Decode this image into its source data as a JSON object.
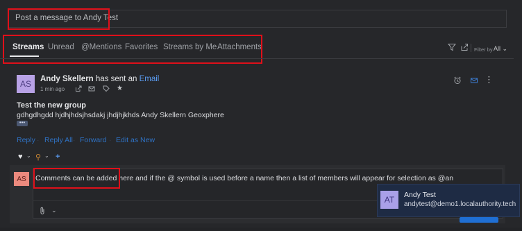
{
  "composer": {
    "placeholder": "Post a message to Andy Test"
  },
  "tabs": [
    {
      "label": "Streams",
      "active": true
    },
    {
      "label": "Unread",
      "active": false
    },
    {
      "label": "@Mentions",
      "active": false
    },
    {
      "label": "Favorites",
      "active": false
    },
    {
      "label": "Streams by Me",
      "active": false
    },
    {
      "label": "Attachments",
      "active": false
    }
  ],
  "toolbar": {
    "filter_label": "Filter by",
    "filter_value": "All",
    "filter_icon": "funnel-icon",
    "share_icon": "share-icon"
  },
  "message": {
    "avatar_initials": "AS",
    "sender_name": "Andy Skellern",
    "sender_action": "has sent an",
    "sender_link": "Email",
    "time": "1 min ago",
    "meta_icons": [
      "external-link-icon",
      "envelope-icon",
      "tag-icon",
      "star-icon"
    ],
    "title": "Test the new group",
    "body": "gdhgdhgdd hjdhjhdsjhsdakj jhdjhjkhds Andy Skellern Geoxphere",
    "more_label": "•••",
    "right_icons": [
      "alarm-icon",
      "mail-icon",
      "kebab-icon"
    ],
    "actions": [
      "Reply",
      "Reply All",
      "Forward",
      "Edit as New"
    ],
    "reactions": [
      "♥",
      "⌄",
      "⚲",
      "⌄",
      "+"
    ]
  },
  "comment": {
    "avatar_initials": "AS",
    "text": "Comments can be added here and if the @ symbol is used before a name then a list of members will appear for selection as @an",
    "attach_icon": "paperclip-icon",
    "chevron": "⌄"
  },
  "mention_suggestion": {
    "avatar_initials": "AT",
    "name": "Andy Test",
    "email": "andytest@demo1.localauthority.tech"
  },
  "colors": {
    "highlight": "#e0101a",
    "link": "#5a9bf0",
    "action": "#2f72c4",
    "popup_bg": "#1e2b44"
  }
}
